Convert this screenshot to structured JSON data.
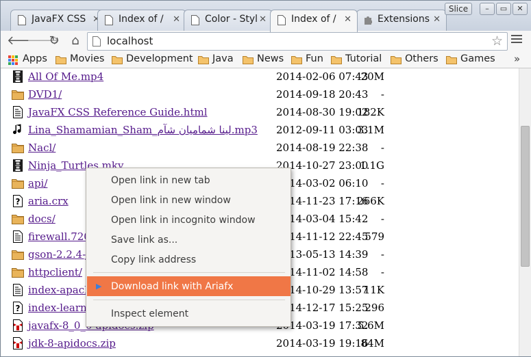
{
  "tabs": [
    {
      "title": "JavaFX CSS",
      "active": false
    },
    {
      "title": "Index of /",
      "active": false
    },
    {
      "title": "Color - Styl",
      "active": false
    },
    {
      "title": "Index of /",
      "active": true
    },
    {
      "title": "Extensions",
      "active": false
    }
  ],
  "window": {
    "slice_label": "Slice"
  },
  "address_bar": {
    "url": "localhost"
  },
  "bookmarks": {
    "apps": "Apps",
    "items": [
      "Movies",
      "Development",
      "Java",
      "News",
      "Fun",
      "Tutorial",
      "Others",
      "Games"
    ],
    "more": "»"
  },
  "files": [
    {
      "name": "All Of Me.mp4",
      "date": "2014-02-06 07:43",
      "size": "20M",
      "icon": "video-icon"
    },
    {
      "name": "DVD1/",
      "date": "2014-09-18 20:43",
      "size": "-",
      "icon": "folder-icon"
    },
    {
      "name": "JavaFX CSS Reference Guide.html",
      "date": "2014-08-30 19:02",
      "size": "182K",
      "icon": "document-icon"
    },
    {
      "name": "Lina_Shamamian_Sham_لينا شماميان شآم.mp3",
      "date": "2012-09-11 03:03",
      "size": "3.1M",
      "icon": "music-icon"
    },
    {
      "name": "Nacl/",
      "date": "2014-08-19 22:38",
      "size": "-",
      "icon": "folder-icon"
    },
    {
      "name": "Ninja_Turtles.mkv",
      "date": "2014-10-27 23:00",
      "size": "1.1G",
      "icon": "video-icon"
    },
    {
      "name": "api/",
      "date": "2014-03-02 06:10",
      "size": "-",
      "icon": "folder-icon"
    },
    {
      "name": "aria.crx",
      "date": "2014-11-23 17:16",
      "size": "266K",
      "icon": "unknown-file-icon"
    },
    {
      "name": "docs/",
      "date": "2014-03-04 15:42",
      "size": "-",
      "icon": "folder-icon"
    },
    {
      "name": "firewall.720.c",
      "date": "2014-11-12 22:45",
      "size": "579",
      "icon": "document-icon"
    },
    {
      "name": "gson-2.2.4-ja",
      "date": "2013-05-13 14:39",
      "size": "-",
      "icon": "folder-icon"
    },
    {
      "name": "httpclient/",
      "date": "2014-11-02 14:58",
      "size": "-",
      "icon": "folder-icon"
    },
    {
      "name": "index-apache",
      "date": "2014-10-29 13:57",
      "size": "11K",
      "icon": "document-icon"
    },
    {
      "name": "index-learn.p",
      "date": "2014-12-17 15:25",
      "size": "296",
      "icon": "unknown-file-icon"
    },
    {
      "name": "javafx-8_0_0-apidocs.zip",
      "date": "2014-03-19 17:32",
      "size": "5.6M",
      "icon": "archive-icon"
    },
    {
      "name": "jdk-8-apidocs.zip",
      "date": "2014-03-19 19:16",
      "size": "84M",
      "icon": "archive-icon"
    }
  ],
  "context_menu": {
    "group1": [
      "Open link in new tab",
      "Open link in new window",
      "Open link in incognito window",
      "Save link as...",
      "Copy link address"
    ],
    "highlighted": "Download link with Ariafx",
    "group3": [
      "Inspect element"
    ]
  },
  "colors": {
    "link_visited": "#551a8b",
    "menu_highlight": "#f07746",
    "menu_arrow": "#3d7ed9",
    "folder": "#e9b45a"
  }
}
